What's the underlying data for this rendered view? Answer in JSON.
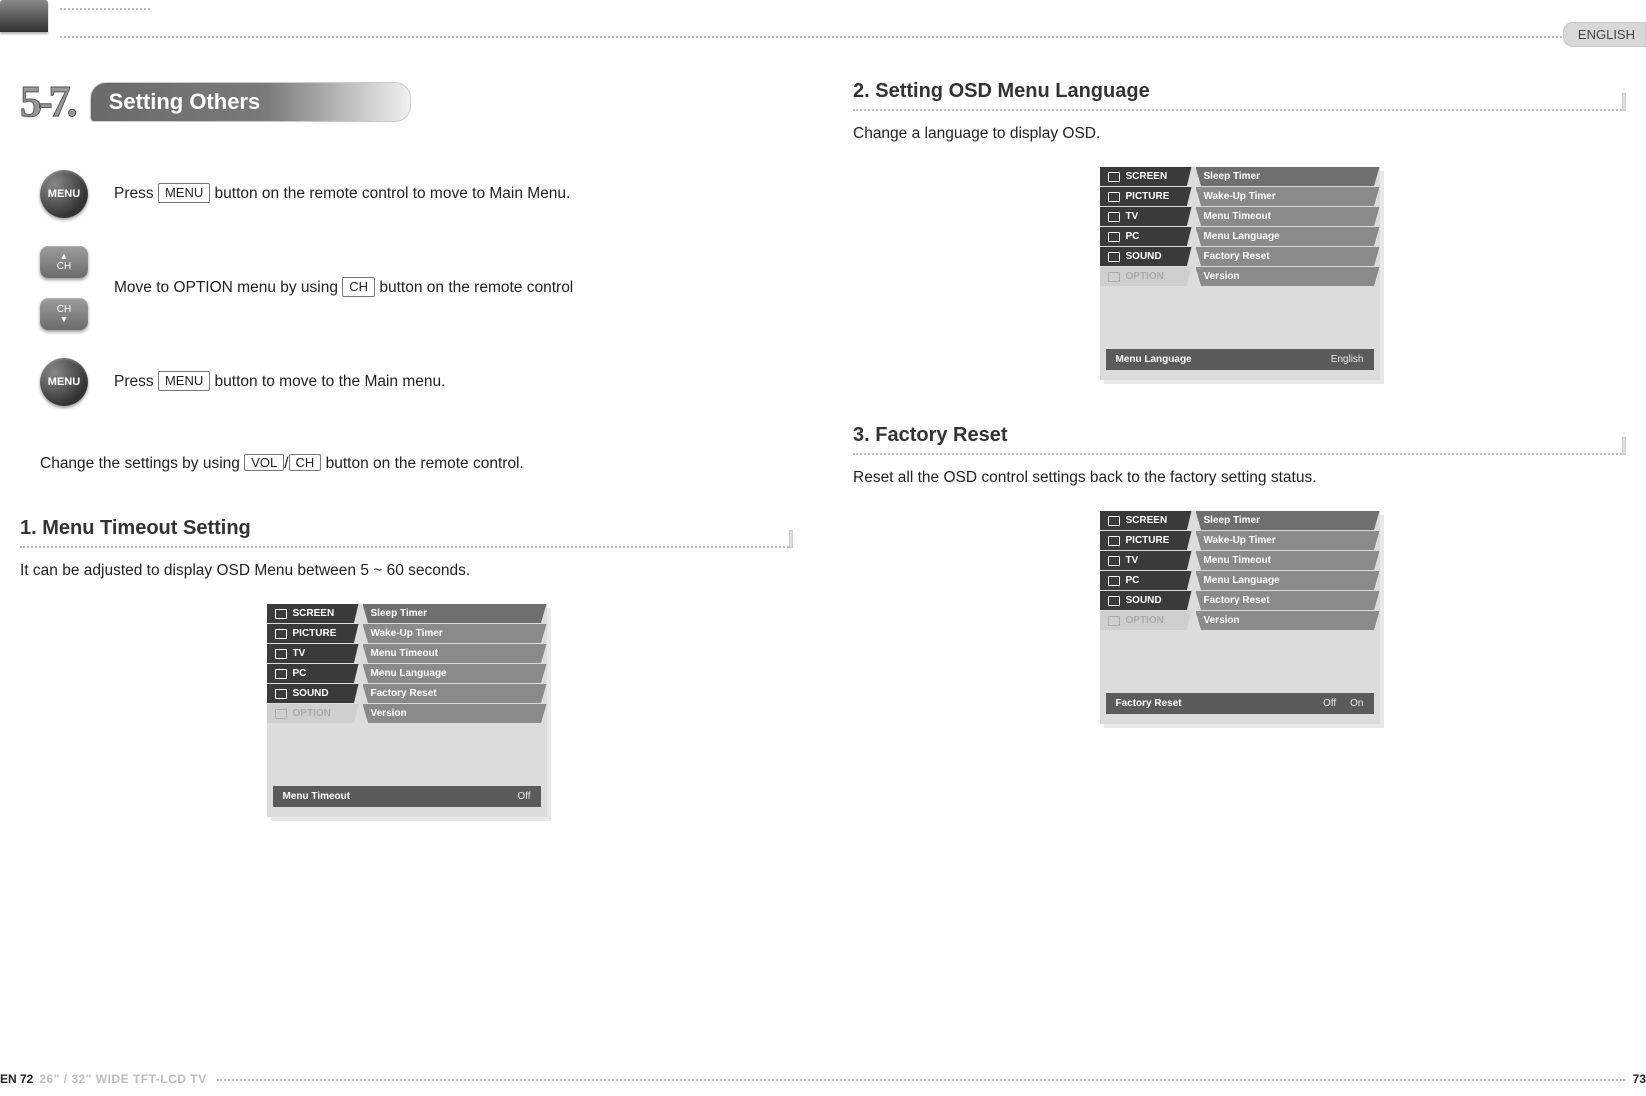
{
  "header": {
    "language": "ENGLISH"
  },
  "section": {
    "number": "5-7.",
    "title": "Setting Others"
  },
  "steps": {
    "menu1": {
      "pre": "Press ",
      "key": "MENU",
      "post": " button on the remote control to move to Main Menu."
    },
    "ch": {
      "pre": "Move to OPTION menu by using ",
      "key": "CH",
      "post": " button on the remote control"
    },
    "menu2": {
      "pre": "Press ",
      "key": "MENU",
      "post": " button to move to the Main menu."
    },
    "settings": {
      "pre": "Change the settings by using ",
      "key1": "VOL",
      "sep": "/",
      "key2": "CH",
      "post": " button on the remote control."
    }
  },
  "buttons": {
    "menu_label": "MENU",
    "ch_label": "CH"
  },
  "s1": {
    "title": "1. Menu Timeout Setting",
    "desc": "It can be adjusted to display OSD Menu between 5 ~ 60 seconds.",
    "footer_label": "Menu Timeout",
    "footer_value": "Off"
  },
  "s2": {
    "title": "2. Setting OSD Menu Language",
    "desc": "Change a language to display OSD.",
    "footer_label": "Menu Language",
    "footer_value": "English"
  },
  "s3": {
    "title": "3. Factory Reset",
    "desc": "Reset all the OSD control settings back to the factory setting status.",
    "footer_label": "Factory Reset",
    "footer_off": "Off",
    "footer_on": "On"
  },
  "osd": {
    "tabs": [
      "SCREEN",
      "PICTURE",
      "TV",
      "PC",
      "SOUND",
      "OPTION"
    ],
    "items": [
      "Sleep Timer",
      "Wake-Up Timer",
      "Menu Timeout",
      "Menu Language",
      "Factory Reset",
      "Version"
    ]
  },
  "footer": {
    "left_page": "EN 72",
    "model": "26\" / 32\" WIDE TFT-LCD TV",
    "right_page": "73"
  }
}
